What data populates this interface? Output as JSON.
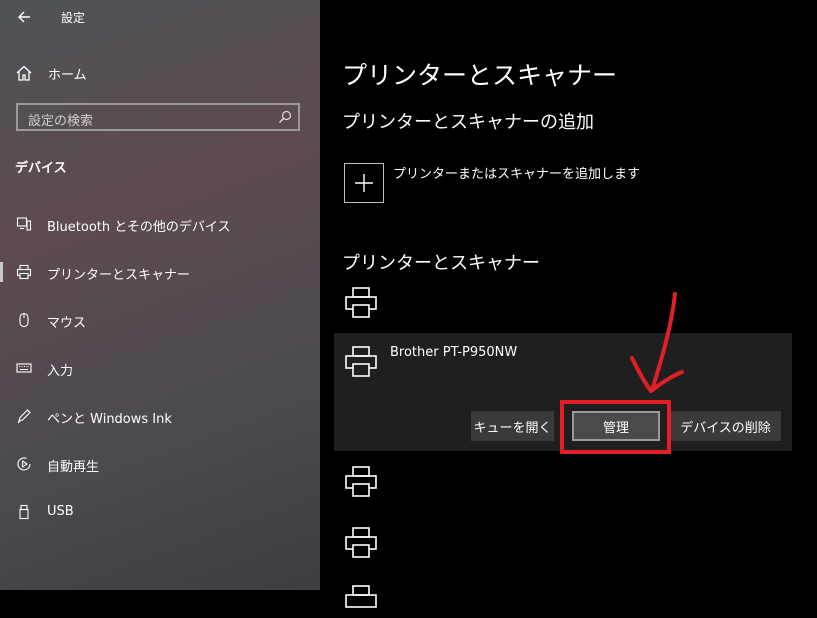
{
  "window": {
    "title": "設定"
  },
  "sidebar": {
    "home_label": "ホーム",
    "search_placeholder": "設定の検索",
    "section_title": "デバイス",
    "items": [
      {
        "label": "Bluetooth とその他のデバイス",
        "icon": "bluetooth-device-icon"
      },
      {
        "label": "プリンターとスキャナー",
        "icon": "printer-icon",
        "selected": true
      },
      {
        "label": "マウス",
        "icon": "mouse-icon"
      },
      {
        "label": "入力",
        "icon": "keyboard-icon"
      },
      {
        "label": "ペンと Windows Ink",
        "icon": "pen-icon"
      },
      {
        "label": "自動再生",
        "icon": "autoplay-icon"
      },
      {
        "label": "USB",
        "icon": "usb-icon"
      }
    ]
  },
  "main": {
    "title": "プリンターとスキャナー",
    "add_section_title": "プリンターとスキャナーの追加",
    "add_button_label": "プリンターまたはスキャナーを追加します",
    "list_title": "プリンターとスキャナー",
    "selected_printer": {
      "name": "Brother PT-P950NW",
      "buttons": {
        "open_queue": "キューを開く",
        "manage": "管理",
        "remove_device": "デバイスの削除"
      }
    }
  },
  "annotation": {
    "color": "#e21f26"
  }
}
